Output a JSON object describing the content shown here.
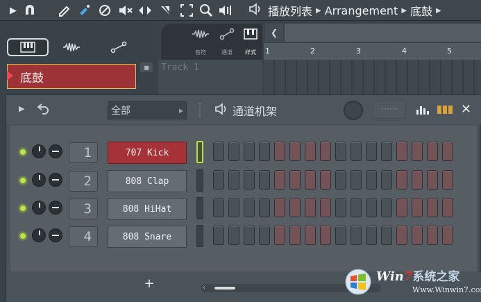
{
  "toolbar": {
    "title": "播放列表",
    "crumb_middle": "Arrangement",
    "crumb_last": "底鼓",
    "icons": [
      "play-arrow-icon",
      "magnet-icon",
      "pencil-icon",
      "paint-icon",
      "delete-icon",
      "mute-icon",
      "slip-icon",
      "slice-icon",
      "select-icon",
      "zoom-icon",
      "playback-icon",
      "speaker-icon"
    ]
  },
  "browser": {
    "pattern_name": "底鼓"
  },
  "playlist": {
    "tools": [
      {
        "icon": "waveform-icon",
        "label": "音符"
      },
      {
        "icon": "automation-icon",
        "label": "通道"
      },
      {
        "icon": "piano-icon",
        "label": "样式"
      }
    ],
    "ruler": [
      "1",
      "2",
      "3",
      "4",
      "5"
    ],
    "track_label": "Track 1"
  },
  "channel_rack": {
    "filter": "全部",
    "title": "通道机架",
    "add_label": "+",
    "channels": [
      {
        "number": "1",
        "name": "707 Kick",
        "selected": true
      },
      {
        "number": "2",
        "name": "808 Clap",
        "selected": false
      },
      {
        "number": "3",
        "name": "808 HiHat",
        "selected": false
      },
      {
        "number": "4",
        "name": "808 Snare",
        "selected": false
      }
    ],
    "step_count": 16
  },
  "watermark": {
    "brand_win": "Win",
    "brand_seven": "7",
    "brand_cn": "系统之家",
    "url": "Www.Winwin7.com"
  },
  "colors": {
    "accent_red": "#a53236",
    "led_green": "#b9e64a",
    "bg": "#3a434a"
  }
}
